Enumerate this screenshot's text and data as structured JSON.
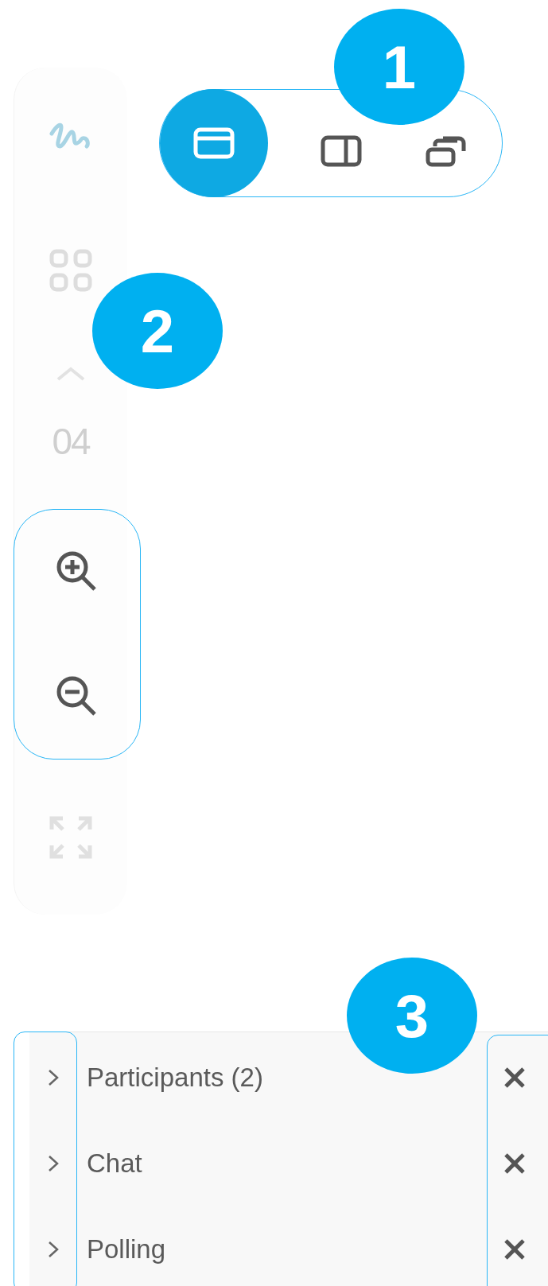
{
  "sidebar": {
    "page_number": "04"
  },
  "layout_switcher": {
    "options": [
      {
        "kind": "gallery",
        "selected": true
      },
      {
        "kind": "split",
        "selected": false
      },
      {
        "kind": "stacked",
        "selected": false
      }
    ]
  },
  "callouts": [
    {
      "label": "1"
    },
    {
      "label": "2"
    },
    {
      "label": "3"
    }
  ],
  "panels": [
    {
      "title": "Participants (2)",
      "expanded": false
    },
    {
      "title": "Chat",
      "expanded": false
    },
    {
      "title": "Polling",
      "expanded": false
    }
  ]
}
